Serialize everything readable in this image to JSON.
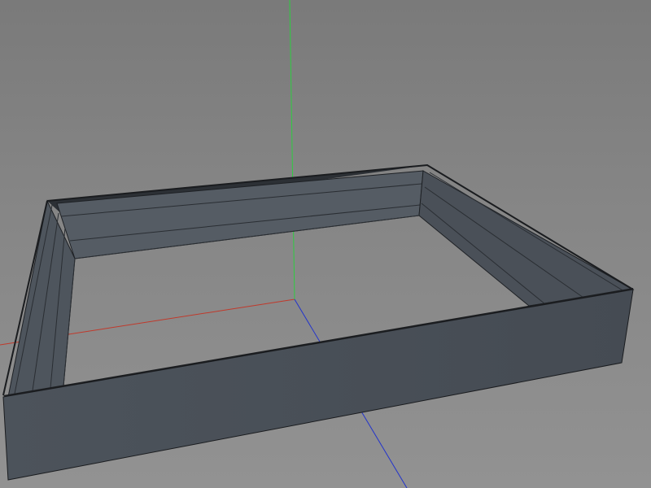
{
  "viewport": {
    "view": "perspective",
    "background_color": "#858585",
    "axis_colors": {
      "x": "#c0392b",
      "y": "#2ecc40",
      "z": "#2233cc"
    },
    "object": {
      "name": "frame",
      "shape": "rectangular frame",
      "face_color": "#4a5058",
      "edge_color": "#1a1c1f"
    }
  }
}
